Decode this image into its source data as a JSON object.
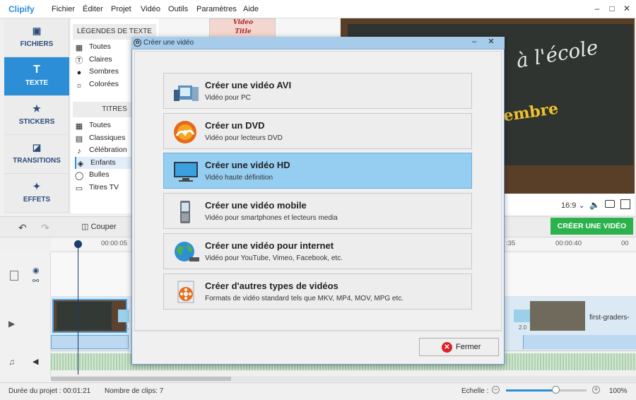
{
  "app": {
    "name": "Clipify"
  },
  "menu": [
    "Fichier",
    "Éditer",
    "Projet",
    "Vidéo",
    "Outils",
    "Paramètres",
    "Aide"
  ],
  "window_controls": {
    "minimize": "–",
    "maximize": "□",
    "close": "✕"
  },
  "leftnav": [
    {
      "label": "FICHIERS",
      "icon": "image-icon"
    },
    {
      "label": "TEXTE",
      "icon": "text-icon"
    },
    {
      "label": "STICKERS",
      "icon": "star-icon"
    },
    {
      "label": "TRANSITIONS",
      "icon": "transitions-icon"
    },
    {
      "label": "EFFETS",
      "icon": "magic-wand-icon"
    }
  ],
  "categories": {
    "legendes_title": "LÉGENDES DE TEXTE",
    "legendes": [
      "Toutes",
      "Claires",
      "Sombres",
      "Colorées"
    ],
    "titres_title": "TITRES",
    "titres": [
      "Toutes",
      "Classiques",
      "Célébration",
      "Enfants",
      "Bulles",
      "Titres TV"
    ],
    "selected": "Enfants"
  },
  "thumbnail": {
    "line1": "Video",
    "line2": "Title"
  },
  "preview": {
    "text1": "à l'école",
    "text2": "embre"
  },
  "aspect_ratio": "16:9",
  "toolbar": {
    "cut_label": "Couper",
    "create_video_label": "CRÉER UNE VIDÉO"
  },
  "timeline": {
    "ticks": [
      "00:00:05",
      ":35",
      "00:00:40",
      "00"
    ],
    "clip_name": "first-graders-",
    "clip_number": "2.0",
    "clip_number_left": "2."
  },
  "status": {
    "duration": "Durée du projet :   00:01:21",
    "clip_count": "Nombre de clips: 7",
    "scale_label": "Echelle :",
    "zoom": "100%",
    "zoom_level": 0.62
  },
  "dialog": {
    "title": "Créer une vidéo",
    "options": [
      {
        "title": "Créer une vidéo AVI",
        "subtitle": "Vidéo pour PC",
        "icon": "avi-video-icon"
      },
      {
        "title": "Créer un DVD",
        "subtitle": "Vidéo pour lecteurs DVD",
        "icon": "dvd-disc-icon"
      },
      {
        "title": "Créer une vidéo HD",
        "subtitle": "Vidéo haute définition",
        "icon": "hd-monitor-icon"
      },
      {
        "title": "Créer une vidéo mobile",
        "subtitle": "Vidéo pour smartphones et lecteurs media",
        "icon": "mobile-phone-icon"
      },
      {
        "title": "Créer une vidéo pour internet",
        "subtitle": "Vidéo pour YouTube, Vimeo, Facebook, etc.",
        "icon": "globe-icon"
      },
      {
        "title": "Créer d'autres types de vidéos",
        "subtitle": "Formats de vidéo standard tels que MKV, MP4, MOV, MPG etc.",
        "icon": "film-reel-icon"
      }
    ],
    "selected_index": 2,
    "close_label": "Fermer"
  },
  "colors": {
    "accent": "#2b8ed6",
    "create_button": "#2bb24c",
    "selected_option": "#96cef1",
    "close_icon": "#d8242a"
  }
}
